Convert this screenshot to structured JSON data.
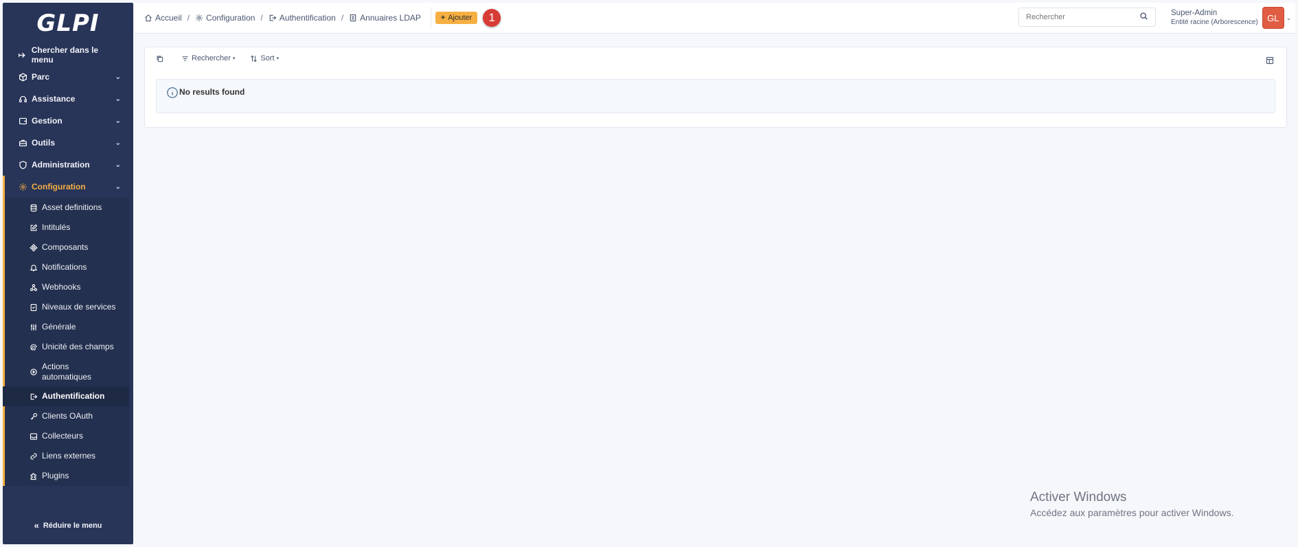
{
  "logo": {
    "text": "GLPI"
  },
  "sidebar": {
    "items": [
      {
        "label": "Chercher dans le menu",
        "icon": "arrow-right-icon",
        "has_chevron": false
      },
      {
        "label": "Parc",
        "icon": "box-icon",
        "has_chevron": true
      },
      {
        "label": "Assistance",
        "icon": "headset-icon",
        "has_chevron": true
      },
      {
        "label": "Gestion",
        "icon": "wallet-icon",
        "has_chevron": true
      },
      {
        "label": "Outils",
        "icon": "briefcase-icon",
        "has_chevron": true
      },
      {
        "label": "Administration",
        "icon": "shield-icon",
        "has_chevron": true
      },
      {
        "label": "Configuration",
        "icon": "gear-icon",
        "has_chevron": true,
        "active": true
      }
    ],
    "config_sub": [
      {
        "label": "Asset definitions",
        "icon": "database-icon"
      },
      {
        "label": "Intitulés",
        "icon": "edit-icon"
      },
      {
        "label": "Composants",
        "icon": "components-icon"
      },
      {
        "label": "Notifications",
        "icon": "bell-icon"
      },
      {
        "label": "Webhooks",
        "icon": "webhook-icon"
      },
      {
        "label": "Niveaux de services",
        "icon": "checklist-icon"
      },
      {
        "label": "Générale",
        "icon": "sliders-icon"
      },
      {
        "label": "Unicité des champs",
        "icon": "fingerprint-icon"
      },
      {
        "label": "Actions automatiques",
        "icon": "settings-automation-icon"
      },
      {
        "label": "Authentification",
        "icon": "login-icon",
        "current": true
      },
      {
        "label": "Clients OAuth",
        "icon": "key-icon"
      },
      {
        "label": "Collecteurs",
        "icon": "inbox-icon"
      },
      {
        "label": "Liens externes",
        "icon": "link-icon"
      },
      {
        "label": "Plugins",
        "icon": "puzzle-icon"
      }
    ],
    "collapse_label": "Réduire le menu"
  },
  "breadcrumb": [
    {
      "label": "Accueil",
      "icon": "home-icon"
    },
    {
      "label": "Configuration",
      "icon": "gear-icon"
    },
    {
      "label": "Authentification",
      "icon": "login-icon"
    },
    {
      "label": "Annuaires LDAP",
      "icon": "address-book-icon"
    }
  ],
  "header": {
    "add_label": "Ajouter",
    "step_badge": "1",
    "search_placeholder": "Rechercher",
    "user_name": "Super-Admin",
    "user_entity": "Entité racine (Arborescence)",
    "avatar_initials": "GL"
  },
  "toolbar": {
    "search_label": "Rechercher",
    "sort_label": "Sort"
  },
  "results": {
    "message": "No results found"
  },
  "watermark": {
    "line1": "Activer Windows",
    "line2": "Accédez aux paramètres pour activer Windows."
  },
  "colors": {
    "sidebar_bg": "#283458",
    "accent": "#f6b042",
    "avatar_bg": "#e05c42",
    "badge_bg": "#d63b34"
  }
}
